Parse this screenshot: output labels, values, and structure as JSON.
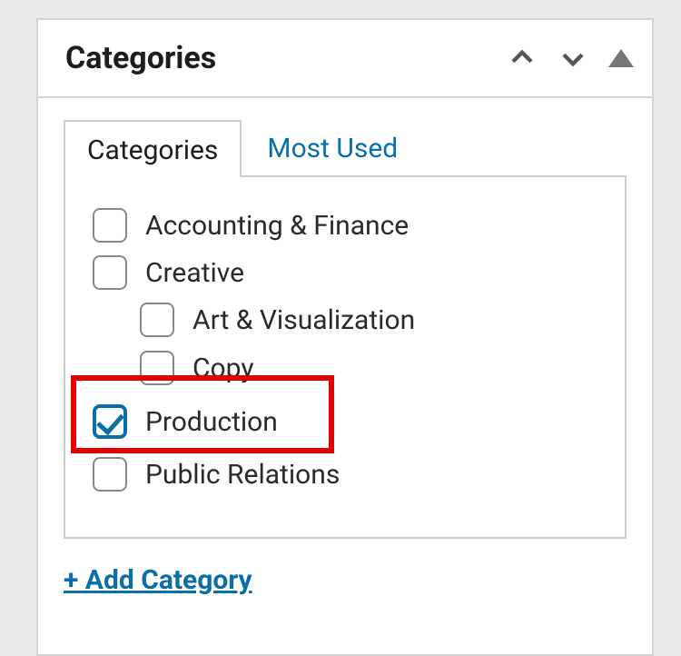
{
  "panel": {
    "title": "Categories"
  },
  "tabs": {
    "active": "Categories",
    "inactive": "Most Used"
  },
  "categories": [
    {
      "label": "Accounting & Finance",
      "checked": false,
      "indent": false
    },
    {
      "label": "Creative",
      "checked": false,
      "indent": false
    },
    {
      "label": "Art & Visualization",
      "checked": false,
      "indent": true
    },
    {
      "label": "Copy",
      "checked": false,
      "indent": true
    },
    {
      "label": "Production",
      "checked": true,
      "indent": false,
      "highlighted": true
    },
    {
      "label": "Public Relations",
      "checked": false,
      "indent": false
    }
  ],
  "actions": {
    "add_label": "+ Add Category"
  }
}
